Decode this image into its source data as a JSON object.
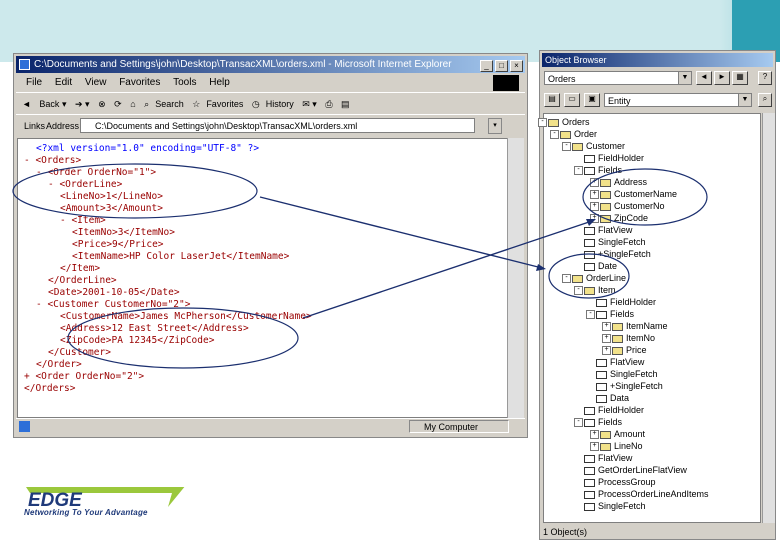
{
  "ie": {
    "title": "C:\\Documents and Settings\\john\\Desktop\\TransacXML\\orders.xml - Microsoft Internet Explorer",
    "menu": [
      "File",
      "Edit",
      "View",
      "Favorites",
      "Tools",
      "Help"
    ],
    "toolbar": {
      "back": "Back",
      "search": "Search",
      "favorites": "Favorites",
      "history": "History"
    },
    "links_label": "Links",
    "address_label": "Address",
    "address_value": "C:\\Documents and Settings\\john\\Desktop\\TransacXML\\orders.xml",
    "status_zone": "My Computer"
  },
  "xml": {
    "l1": "<?xml version=\"1.0\" encoding=\"UTF-8\" ?>",
    "l2": "- <Orders>",
    "l3": "- <Order OrderNo=\"1\">",
    "l4": "- <OrderLine>",
    "l5": "<LineNo>1</LineNo>",
    "l6": "<Amount>3</Amount>",
    "l7": "- <Item>",
    "l8": "<ItemNo>3</ItemNo>",
    "l9": "<Price>9</Price>",
    "l10": "<ItemName>HP Color LaserJet</ItemName>",
    "l11": "</Item>",
    "l12": "</OrderLine>",
    "l13": "<Date>2001-10-05</Date>",
    "l14": "- <Customer CustomerNo=\"2\">",
    "l15": "<CustomerName>James McPherson</CustomerName>",
    "l16": "<Address>12 East Street</Address>",
    "l17": "<ZipCode>PA 12345</ZipCode>",
    "l18": "</Customer>",
    "l19": "</Order>",
    "l20": "+ <Order OrderNo=\"2\">",
    "l21": "</Orders>"
  },
  "ob": {
    "title": "Object Browser",
    "combo1": "Orders",
    "combo2": "Entity",
    "status": "1 Object(s)",
    "tree": [
      "Orders",
      "Order",
      "Customer",
      "FieldHolder",
      "Fields",
      "Address",
      "CustomerName",
      "CustomerNo",
      "ZipCode",
      "FlatView",
      "SingleFetch",
      "+SingleFetch",
      "Date",
      "OrderLine",
      "Item",
      "FieldHolder",
      "Fields",
      "ItemName",
      "ItemNo",
      "Price",
      "FlatView",
      "SingleFetch",
      "+SingleFetch",
      "Data",
      "FieldHolder",
      "Fields",
      "Amount",
      "LineNo",
      "FlatView",
      "GetOrderLineFlatView",
      "ProcessGroup",
      "ProcessOrderLineAndItems",
      "SingleFetch"
    ]
  },
  "brand": {
    "logo": "EDGE",
    "tagline": "Networking To Your Advantage"
  }
}
